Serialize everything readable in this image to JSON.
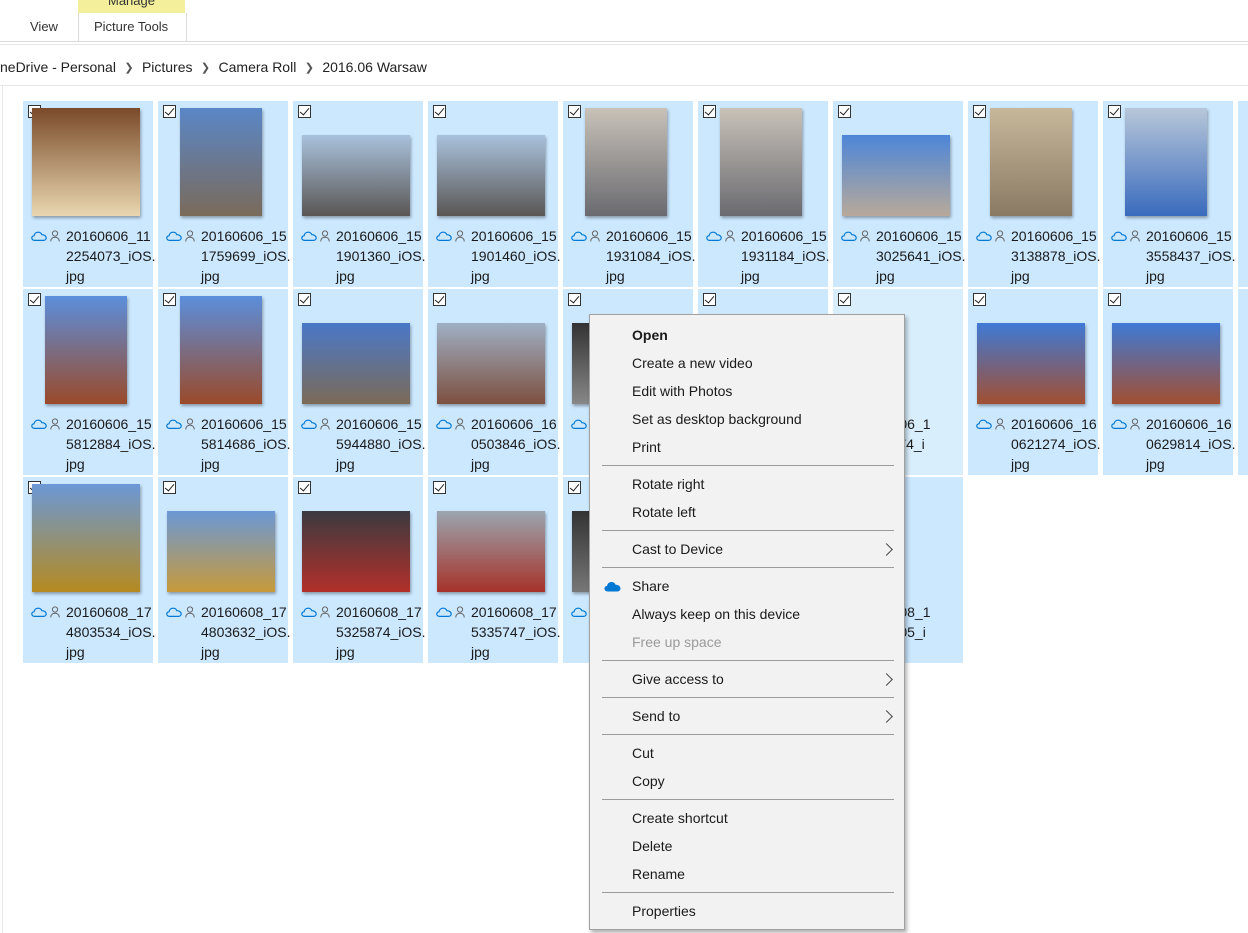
{
  "ribbon": {
    "view_tab": "View",
    "manage_tab": "Manage",
    "picture_tools_tab": "Picture Tools"
  },
  "breadcrumb": [
    "neDrive - Personal",
    "Pictures",
    "Camera Roll",
    "2016.06 Warsaw"
  ],
  "files": [
    {
      "name": "20160606_112254073_iOS.jpg"
    },
    {
      "name": "20160606_151759699_iOS.jpg"
    },
    {
      "name": "20160606_151901360_iOS.jpg"
    },
    {
      "name": "20160606_151901460_iOS.jpg"
    },
    {
      "name": "20160606_151931084_iOS.jpg"
    },
    {
      "name": "20160606_151931184_iOS.jpg"
    },
    {
      "name": "20160606_153025641_iOS.jpg"
    },
    {
      "name": "20160606_153138878_iOS.jpg"
    },
    {
      "name": "20160606_153558437_iOS.jpg"
    },
    {
      "name": "20160606_155812884_iOS.jpg"
    },
    {
      "name": "20160606_155814686_iOS.jpg"
    },
    {
      "name": "20160606_155944880_iOS.jpg"
    },
    {
      "name": "20160606_160503846_iOS.jpg"
    },
    {
      "name": ""
    },
    {
      "name": ""
    },
    {
      "name": "60606_1\n21174_i\nog"
    },
    {
      "name": "20160606_160621274_iOS.jpg"
    },
    {
      "name": "20160606_160629814_iOS.jpg"
    },
    {
      "name": "20160608_174803534_iOS.jpg"
    },
    {
      "name": "20160608_174803632_iOS.jpg"
    },
    {
      "name": "20160608_175325874_iOS.jpg"
    },
    {
      "name": "20160608_175335747_iOS.jpg"
    },
    {
      "name": ""
    },
    {
      "name": ""
    },
    {
      "name": "60608_1\n33305_i\nog"
    }
  ],
  "context_menu": {
    "open": "Open",
    "create_video": "Create a new video",
    "edit_photos": "Edit with Photos",
    "set_background": "Set as desktop background",
    "print": "Print",
    "rotate_right": "Rotate right",
    "rotate_left": "Rotate left",
    "cast": "Cast to Device",
    "share": "Share",
    "keep": "Always keep on this device",
    "free_space": "Free up space",
    "give_access": "Give access to",
    "send_to": "Send to",
    "cut": "Cut",
    "copy": "Copy",
    "shortcut": "Create shortcut",
    "delete": "Delete",
    "rename": "Rename",
    "properties": "Properties"
  },
  "colors": {
    "selection": "#cce8ff",
    "onedrive_blue": "#0078d4",
    "manage_tab": "#f3ef9a"
  }
}
